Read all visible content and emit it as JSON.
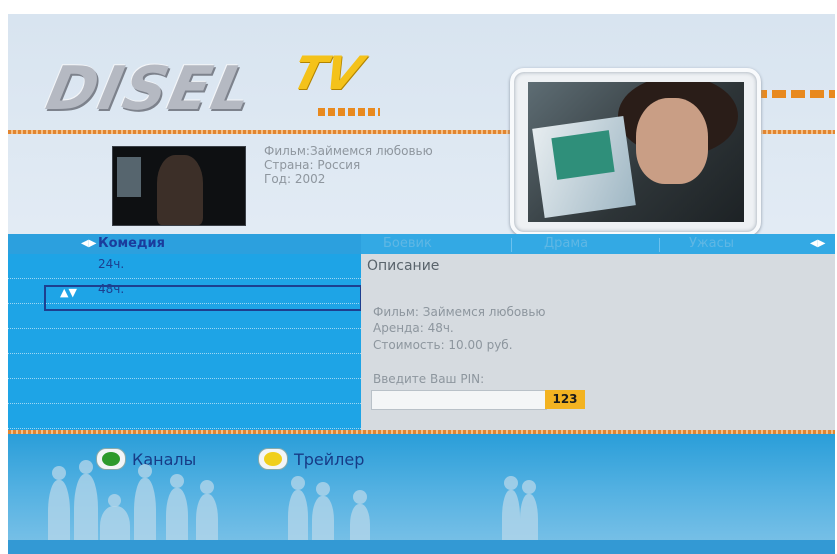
{
  "header": {
    "logo_main": "DISEL",
    "logo_tv": "TV"
  },
  "movie_info": {
    "film": "Фильм:Займемся любовью",
    "country": "Страна: Россия",
    "year": "Год: 2002"
  },
  "tabs": {
    "active": "Комедия",
    "items": [
      "Боевик",
      "Драма",
      "Ужасы"
    ],
    "arrow_left": "◀▶",
    "arrow_right": "◀▶"
  },
  "rental_list": {
    "items": [
      {
        "label": "24ч.",
        "selected": false
      },
      {
        "label": "48ч.",
        "selected": true
      }
    ],
    "selection_icon": "▲▼"
  },
  "description": {
    "title": "Описание",
    "film": "Фильм: Займемся любовью",
    "rent": "Аренда: 48ч.",
    "cost": "Стоимость: 10.00 руб.",
    "pin_label": "Введите Ваш PIN:",
    "pin_value": "123"
  },
  "footer": {
    "channels_label": "Каналы",
    "trailer_label": "Трейлер"
  },
  "colors": {
    "accent_blue": "#1ea4e6",
    "orange": "#e28530",
    "green_button": "#2d9a2c",
    "yellow_button": "#f0cf1c"
  }
}
